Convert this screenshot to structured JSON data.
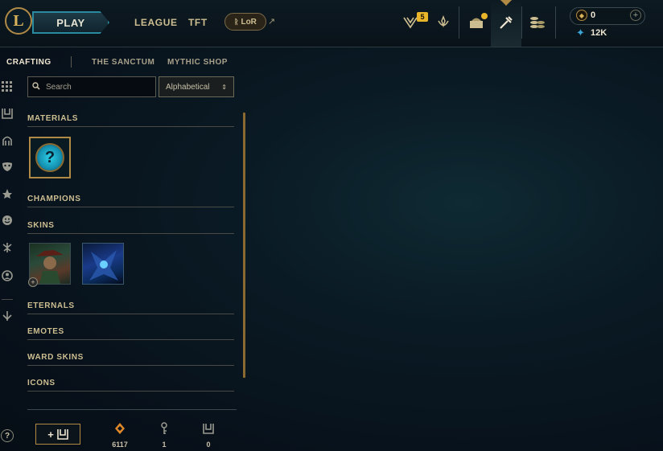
{
  "topbar": {
    "logo_letter": "L",
    "play_label": "PLAY",
    "league_label": "LEAGUE",
    "tft_label": "TFT",
    "lor_label": "LoR",
    "external_glyph": "↗",
    "notification_count": "5",
    "rp_value": "0",
    "be_value": "12K"
  },
  "subnav": {
    "crafting": "CRAFTING",
    "sanctum": "THE SANCTUM",
    "mythic": "MYTHIC SHOP"
  },
  "search": {
    "placeholder": "Search",
    "value": ""
  },
  "sort": {
    "selected": "Alphabetical"
  },
  "sections": [
    {
      "title": "MATERIALS"
    },
    {
      "title": "CHAMPIONS"
    },
    {
      "title": "SKINS"
    },
    {
      "title": "ETERNALS"
    },
    {
      "title": "EMOTES"
    },
    {
      "title": "WARD SKINS"
    },
    {
      "title": "ICONS"
    }
  ],
  "materials": {
    "mystery_glyph": "?"
  },
  "resources": {
    "add_glyph": "+",
    "orange_essence": "6117",
    "keys": "1",
    "chests": "0"
  },
  "help_glyph": "?",
  "colors": {
    "gold": "#b08a44",
    "gold_text": "#cdbe91",
    "blue_accent": "#2a8aa0",
    "badge_yellow": "#e8b52a",
    "blue_essence": "#3aa6d8",
    "orange_essence": "#e0892a"
  },
  "icons": {
    "top": [
      "logo-icon",
      "challenges-icon",
      "honor-icon",
      "loot-icon",
      "crafting-icon",
      "store-icon",
      "rp-icon",
      "blue-essence-icon"
    ],
    "sidebar": [
      "all-grid-icon",
      "chest-icon",
      "helmet-icon",
      "mask-icon",
      "ward-icon",
      "emote-icon",
      "eternals-icon",
      "profile-icon",
      "other-icon"
    ]
  }
}
